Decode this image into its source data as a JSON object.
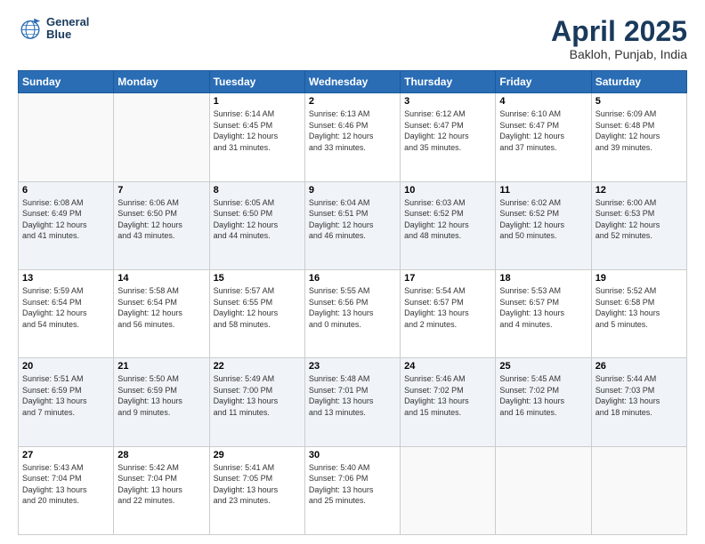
{
  "logo": {
    "line1": "General",
    "line2": "Blue"
  },
  "title": "April 2025",
  "subtitle": "Bakloh, Punjab, India",
  "days_header": [
    "Sunday",
    "Monday",
    "Tuesday",
    "Wednesday",
    "Thursday",
    "Friday",
    "Saturday"
  ],
  "weeks": [
    [
      {
        "day": "",
        "info": ""
      },
      {
        "day": "",
        "info": ""
      },
      {
        "day": "1",
        "info": "Sunrise: 6:14 AM\nSunset: 6:45 PM\nDaylight: 12 hours\nand 31 minutes."
      },
      {
        "day": "2",
        "info": "Sunrise: 6:13 AM\nSunset: 6:46 PM\nDaylight: 12 hours\nand 33 minutes."
      },
      {
        "day": "3",
        "info": "Sunrise: 6:12 AM\nSunset: 6:47 PM\nDaylight: 12 hours\nand 35 minutes."
      },
      {
        "day": "4",
        "info": "Sunrise: 6:10 AM\nSunset: 6:47 PM\nDaylight: 12 hours\nand 37 minutes."
      },
      {
        "day": "5",
        "info": "Sunrise: 6:09 AM\nSunset: 6:48 PM\nDaylight: 12 hours\nand 39 minutes."
      }
    ],
    [
      {
        "day": "6",
        "info": "Sunrise: 6:08 AM\nSunset: 6:49 PM\nDaylight: 12 hours\nand 41 minutes."
      },
      {
        "day": "7",
        "info": "Sunrise: 6:06 AM\nSunset: 6:50 PM\nDaylight: 12 hours\nand 43 minutes."
      },
      {
        "day": "8",
        "info": "Sunrise: 6:05 AM\nSunset: 6:50 PM\nDaylight: 12 hours\nand 44 minutes."
      },
      {
        "day": "9",
        "info": "Sunrise: 6:04 AM\nSunset: 6:51 PM\nDaylight: 12 hours\nand 46 minutes."
      },
      {
        "day": "10",
        "info": "Sunrise: 6:03 AM\nSunset: 6:52 PM\nDaylight: 12 hours\nand 48 minutes."
      },
      {
        "day": "11",
        "info": "Sunrise: 6:02 AM\nSunset: 6:52 PM\nDaylight: 12 hours\nand 50 minutes."
      },
      {
        "day": "12",
        "info": "Sunrise: 6:00 AM\nSunset: 6:53 PM\nDaylight: 12 hours\nand 52 minutes."
      }
    ],
    [
      {
        "day": "13",
        "info": "Sunrise: 5:59 AM\nSunset: 6:54 PM\nDaylight: 12 hours\nand 54 minutes."
      },
      {
        "day": "14",
        "info": "Sunrise: 5:58 AM\nSunset: 6:54 PM\nDaylight: 12 hours\nand 56 minutes."
      },
      {
        "day": "15",
        "info": "Sunrise: 5:57 AM\nSunset: 6:55 PM\nDaylight: 12 hours\nand 58 minutes."
      },
      {
        "day": "16",
        "info": "Sunrise: 5:55 AM\nSunset: 6:56 PM\nDaylight: 13 hours\nand 0 minutes."
      },
      {
        "day": "17",
        "info": "Sunrise: 5:54 AM\nSunset: 6:57 PM\nDaylight: 13 hours\nand 2 minutes."
      },
      {
        "day": "18",
        "info": "Sunrise: 5:53 AM\nSunset: 6:57 PM\nDaylight: 13 hours\nand 4 minutes."
      },
      {
        "day": "19",
        "info": "Sunrise: 5:52 AM\nSunset: 6:58 PM\nDaylight: 13 hours\nand 5 minutes."
      }
    ],
    [
      {
        "day": "20",
        "info": "Sunrise: 5:51 AM\nSunset: 6:59 PM\nDaylight: 13 hours\nand 7 minutes."
      },
      {
        "day": "21",
        "info": "Sunrise: 5:50 AM\nSunset: 6:59 PM\nDaylight: 13 hours\nand 9 minutes."
      },
      {
        "day": "22",
        "info": "Sunrise: 5:49 AM\nSunset: 7:00 PM\nDaylight: 13 hours\nand 11 minutes."
      },
      {
        "day": "23",
        "info": "Sunrise: 5:48 AM\nSunset: 7:01 PM\nDaylight: 13 hours\nand 13 minutes."
      },
      {
        "day": "24",
        "info": "Sunrise: 5:46 AM\nSunset: 7:02 PM\nDaylight: 13 hours\nand 15 minutes."
      },
      {
        "day": "25",
        "info": "Sunrise: 5:45 AM\nSunset: 7:02 PM\nDaylight: 13 hours\nand 16 minutes."
      },
      {
        "day": "26",
        "info": "Sunrise: 5:44 AM\nSunset: 7:03 PM\nDaylight: 13 hours\nand 18 minutes."
      }
    ],
    [
      {
        "day": "27",
        "info": "Sunrise: 5:43 AM\nSunset: 7:04 PM\nDaylight: 13 hours\nand 20 minutes."
      },
      {
        "day": "28",
        "info": "Sunrise: 5:42 AM\nSunset: 7:04 PM\nDaylight: 13 hours\nand 22 minutes."
      },
      {
        "day": "29",
        "info": "Sunrise: 5:41 AM\nSunset: 7:05 PM\nDaylight: 13 hours\nand 23 minutes."
      },
      {
        "day": "30",
        "info": "Sunrise: 5:40 AM\nSunset: 7:06 PM\nDaylight: 13 hours\nand 25 minutes."
      },
      {
        "day": "",
        "info": ""
      },
      {
        "day": "",
        "info": ""
      },
      {
        "day": "",
        "info": ""
      }
    ]
  ]
}
